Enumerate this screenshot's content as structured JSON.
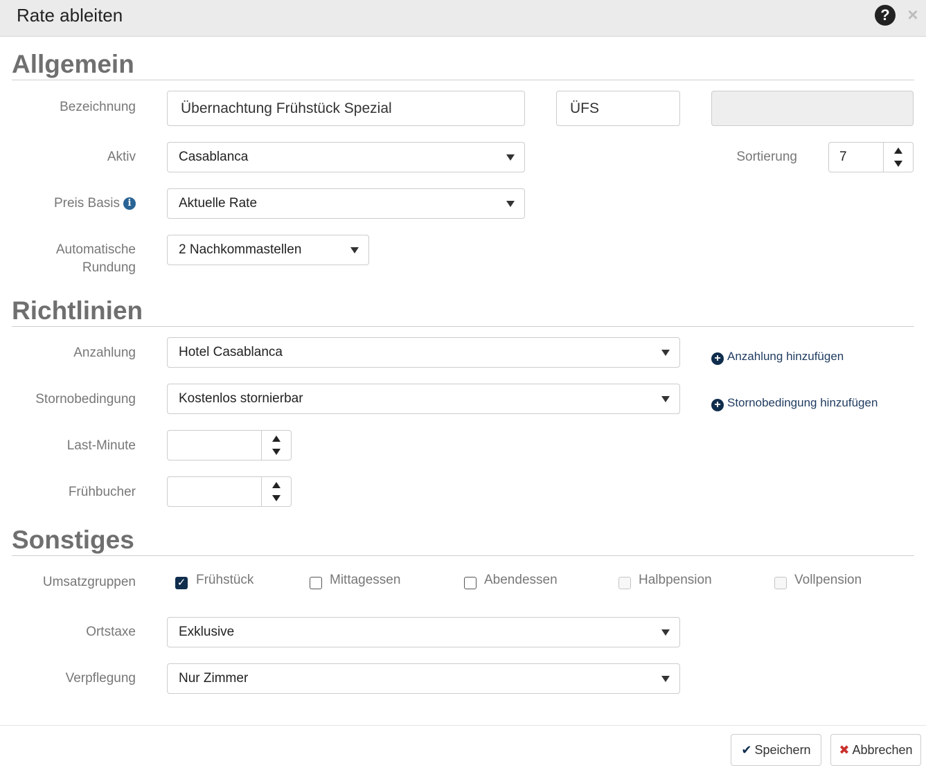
{
  "dialog": {
    "title": "Rate ableiten"
  },
  "sections": {
    "general": "Allgemein",
    "policies": "Richtlinien",
    "other": "Sonstiges"
  },
  "general": {
    "name_label": "Bezeichnung",
    "name_value": "Übernachtung Frühstück Spezial",
    "code_value": "ÜFS",
    "third_value": "",
    "active_label": "Aktiv",
    "active_value": "Casablanca",
    "sort_label": "Sortierung",
    "sort_value": "7",
    "price_basis_label": "Preis Basis",
    "price_basis_value": "Aktuelle Rate",
    "rounding_label_line1": "Automatische",
    "rounding_label_line2": "Rundung",
    "rounding_value": "2 Nachkommastellen"
  },
  "policies": {
    "deposit_label": "Anzahlung",
    "deposit_value": "Hotel Casablanca",
    "deposit_add": "Anzahlung hinzufügen",
    "cancel_label": "Stornobedingung",
    "cancel_value": "Kostenlos stornierbar",
    "cancel_add": "Stornobedingung hinzufügen",
    "lastminute_label": "Last-Minute",
    "lastminute_value": "",
    "earlybird_label": "Frühbucher",
    "earlybird_value": ""
  },
  "other": {
    "revenue_label": "Umsatzgruppen",
    "revenue_groups": [
      {
        "label": "Frühstück",
        "checked": true,
        "disabled": false
      },
      {
        "label": "Mittagessen",
        "checked": false,
        "disabled": false
      },
      {
        "label": "Abendessen",
        "checked": false,
        "disabled": false
      },
      {
        "label": "Halbpension",
        "checked": false,
        "disabled": true
      },
      {
        "label": "Vollpension",
        "checked": false,
        "disabled": true
      }
    ],
    "tax_label": "Ortstaxe",
    "tax_value": "Exklusive",
    "board_label": "Verpflegung",
    "board_value": "Nur Zimmer"
  },
  "footer": {
    "save": "Speichern",
    "cancel": "Abbrechen"
  },
  "icons": {
    "help": "question-circle-icon",
    "close": "close-icon",
    "info": "info-circle-icon",
    "add": "plus-circle-icon",
    "check": "check-icon",
    "x": "x-icon"
  },
  "colors": {
    "accent": "#0f2d4d",
    "info": "#2a6496",
    "danger": "#c9302c"
  }
}
